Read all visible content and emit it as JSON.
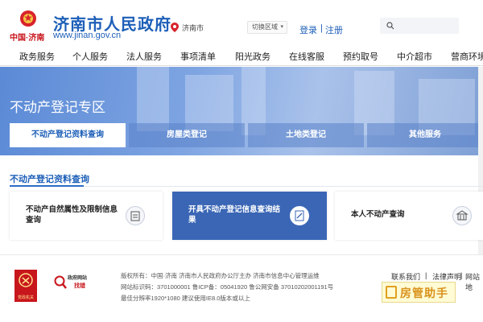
{
  "header": {
    "brand_red": "中国·济南",
    "site_title": "济南市人民政府",
    "site_url": "www.jinan.gov.cn",
    "location": "济南市",
    "region_switch": "切换区域",
    "login": "登录",
    "separator": "|",
    "register": "注册"
  },
  "nav": {
    "items": [
      "政务服务",
      "个人服务",
      "法人服务",
      "事项清单",
      "阳光政务",
      "在线客服",
      "预约取号",
      "中介超市",
      "营商环境"
    ]
  },
  "banner": {
    "title": "不动产登记专区",
    "tabs": [
      "不动产登记资料查询",
      "房屋类登记",
      "土地类登记",
      "其他服务"
    ]
  },
  "section": {
    "title": "不动产登记资料查询",
    "cards": [
      {
        "line1": "不动产自然属性及限制信息",
        "line2": "查询"
      },
      {
        "line1": "开具不动产登记信息查询结",
        "line2": "果"
      },
      {
        "line1": "本人不动产查询",
        "line2": ""
      }
    ]
  },
  "footer": {
    "party_label": "党政机关",
    "gov_site": "政府网站",
    "find_error": "找错",
    "line1": "版权所有：中国·济南 济南市人民政府办公厅主办 济南市信息中心管理运维",
    "line2": "网站标识码：3701000001 鲁ICP备：05041920 鲁公网安备 37010202001191号",
    "line3": "最佳分辨率1920*1080 建议使用IE8.0版本或以上",
    "links": [
      "联系我们",
      "|",
      "法律声明",
      "|",
      "网站地"
    ],
    "watermark": "房管助手"
  }
}
